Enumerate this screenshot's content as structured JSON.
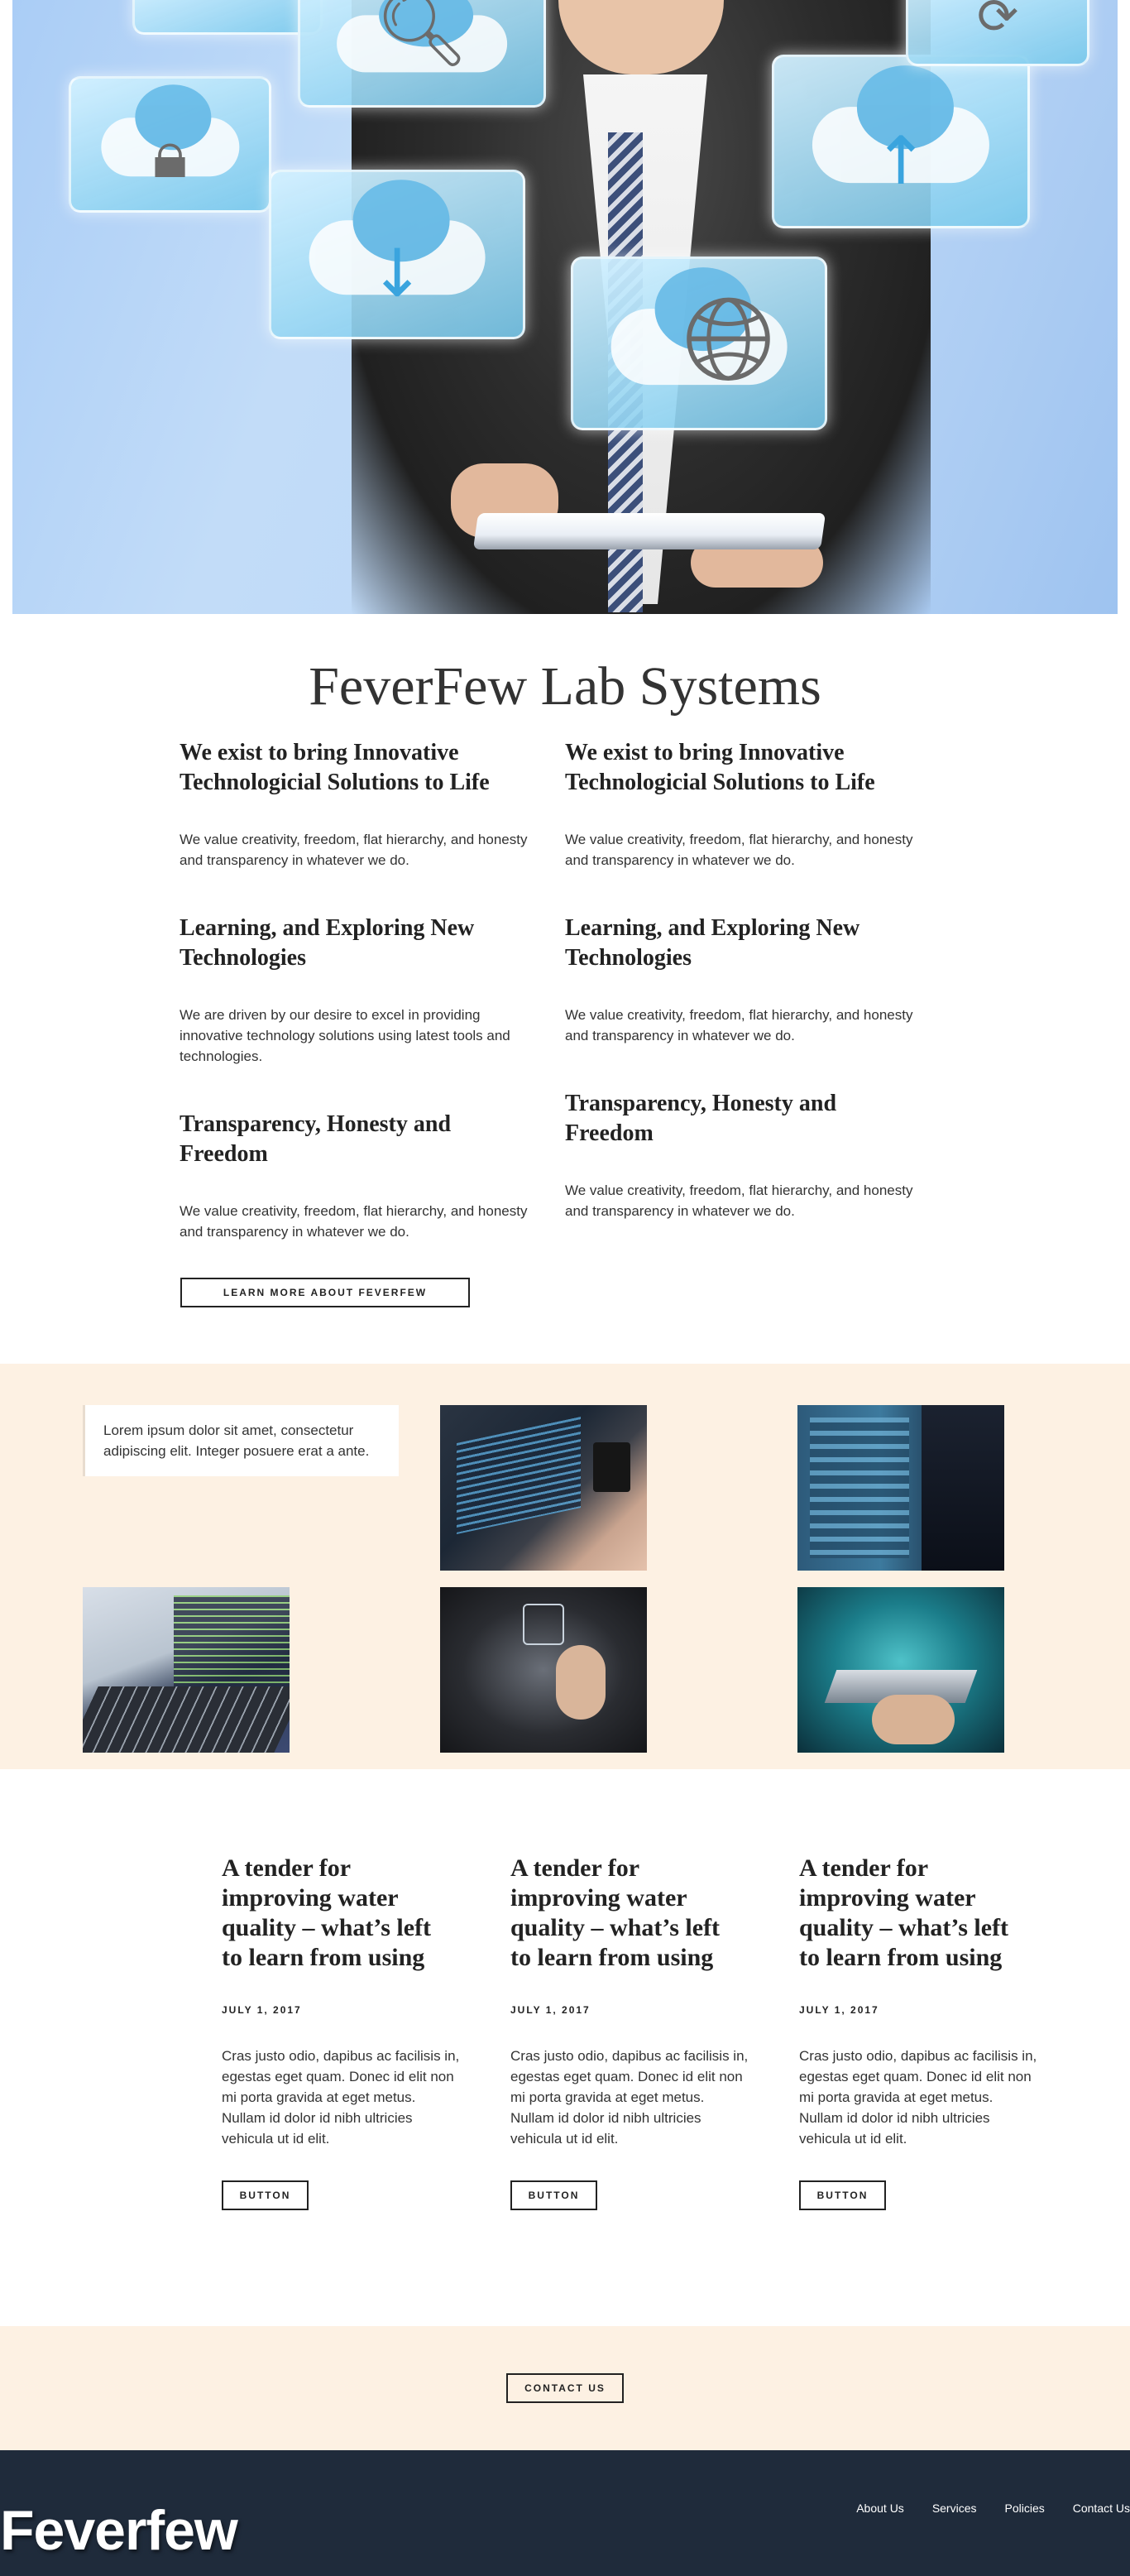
{
  "site": {
    "title": "FeverFew Lab Systems"
  },
  "features": {
    "left": [
      {
        "heading": "We exist to bring Innovative Technologicial Solutions to Life",
        "text": "We value creativity, freedom, flat hierarchy, and honesty and transparency in whatever we do."
      },
      {
        "heading": "Learning, and Exploring New Technologies",
        "text": "We are driven by our desire to excel in providing innovative technology solutions using latest tools and technologies."
      },
      {
        "heading": "Transparency, Honesty and Freedom",
        "text": "We value creativity, freedom, flat hierarchy, and honesty and transparency in whatever we do."
      }
    ],
    "right": [
      {
        "heading": "We exist to bring Innovative Technologicial Solutions to Life",
        "text": "We value creativity, freedom, flat hierarchy, and honesty and transparency in whatever we do."
      },
      {
        "heading": "Learning, and Exploring New Technologies",
        "text": "We value creativity, freedom, flat hierarchy, and honesty and transparency in whatever we do."
      },
      {
        "heading": "Transparency, Honesty and Freedom",
        "text": "We value creativity, freedom, flat hierarchy, and honesty and transparency in whatever we do."
      }
    ],
    "learn_more_label": "LEARN MORE ABOUT FEVERFEW"
  },
  "gallery": {
    "quote": "Lorem ipsum dolor sit amet, consectetur adipiscing elit. Integer posuere erat a ante."
  },
  "articles": [
    {
      "title": "A tender for improving water quality – what’s left to learn from using",
      "date": "JULY 1, 2017",
      "body": "Cras justo odio, dapibus ac facilisis in, egestas eget quam. Donec id elit non mi porta gravida at eget metus. Nullam id dolor id nibh ultricies vehicula ut id elit.",
      "button": "BUTTON"
    },
    {
      "title": "A tender for improving water quality – what’s left to learn from using",
      "date": "JULY 1, 2017",
      "body": "Cras justo odio, dapibus ac facilisis in, egestas eget quam. Donec id elit non mi porta gravida at eget metus. Nullam id dolor id nibh ultricies vehicula ut id elit.",
      "button": "BUTTON"
    },
    {
      "title": "A tender for improving water quality – what’s left to learn from using",
      "date": "JULY 1, 2017",
      "body": "Cras justo odio, dapibus ac facilisis in, egestas eget quam. Donec id elit non mi porta gravida at eget metus. Nullam id dolor id nibh ultricies vehicula ut id elit.",
      "button": "BUTTON"
    }
  ],
  "contact": {
    "button": "CONTACT US"
  },
  "footer": {
    "logo": "Feverfew",
    "nav": [
      "About Us",
      "Services",
      "Policies",
      "Contact Us"
    ]
  },
  "colors": {
    "cream": "#fdf1e3",
    "footer_bg": "#1f2b3b",
    "hero_sky": "#aacdf6",
    "tile_blue": "#62b8e6"
  },
  "icons": [
    "lock-icon",
    "magnifier-icon",
    "download-cloud-icon",
    "upload-cloud-icon",
    "globe-icon",
    "refresh-icon"
  ]
}
